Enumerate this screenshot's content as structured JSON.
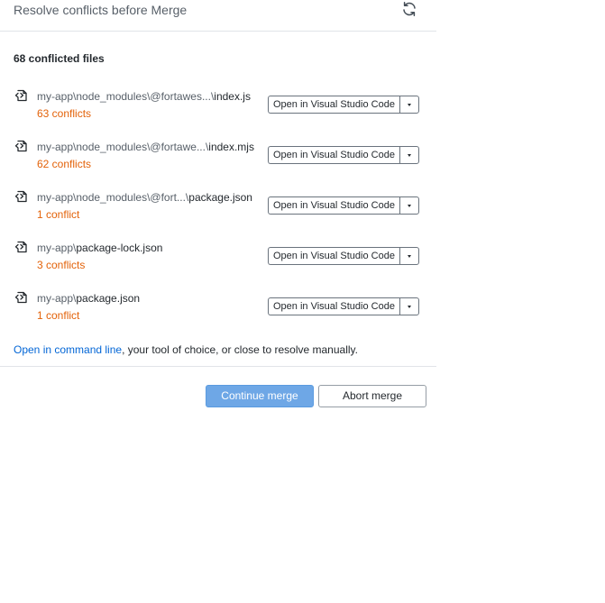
{
  "dialog": {
    "title": "Resolve conflicts before Merge",
    "refresh_icon": "refresh-icon"
  },
  "summary": "68 conflicted files",
  "files": [
    {
      "path": "my-app\\node_modules\\@fortawes...\\",
      "name": "index.js",
      "conflicts": "63 conflicts",
      "open_label": "Open in Visual Studio Code"
    },
    {
      "path": "my-app\\node_modules\\@fortawe...\\",
      "name": "index.mjs",
      "conflicts": "62 conflicts",
      "open_label": "Open in Visual Studio Code"
    },
    {
      "path": "my-app\\node_modules\\@fort...\\",
      "name": "package.json",
      "conflicts": "1 conflict",
      "open_label": "Open in Visual Studio Code"
    },
    {
      "path": "my-app\\",
      "name": "package-lock.json",
      "conflicts": "3 conflicts",
      "open_label": "Open in Visual Studio Code"
    },
    {
      "path": "my-app\\",
      "name": "package.json",
      "conflicts": "1 conflict",
      "open_label": "Open in Visual Studio Code"
    }
  ],
  "footer": {
    "link_text": "Open in command line",
    "rest_text": ", your tool of choice, or close to resolve manually."
  },
  "buttons": {
    "continue_label": "Continue merge",
    "abort_label": "Abort merge"
  },
  "colors": {
    "conflict": "#e36209",
    "link": "#0366d6",
    "primary": "#6ea7e6"
  }
}
